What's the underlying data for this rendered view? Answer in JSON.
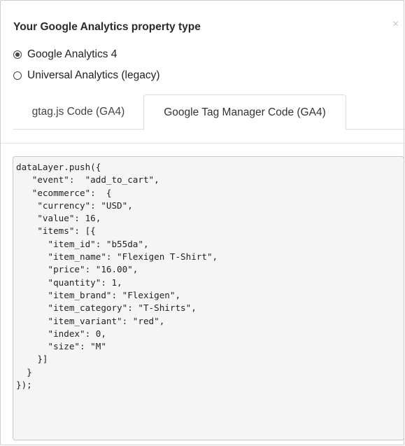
{
  "dialog": {
    "title": "Your Google Analytics property type",
    "close_icon": "close-icon",
    "close_glyph": "×"
  },
  "property_types": [
    {
      "label": "Google Analytics 4",
      "selected": true
    },
    {
      "label": "Universal Analytics (legacy)",
      "selected": false
    }
  ],
  "tabs": [
    {
      "label": "gtag.js Code (GA4)",
      "active": false
    },
    {
      "label": "Google Tag Manager Code (GA4)",
      "active": true
    }
  ],
  "code": {
    "lines": [
      "dataLayer.push({",
      "   \"event\":  \"add_to_cart\",",
      "   \"ecommerce\":  {",
      "    \"currency\": \"USD\",",
      "    \"value\": 16,",
      "    \"items\": [{",
      "      \"item_id\": \"b55da\",",
      "      \"item_name\": \"Flexigen T-Shirt\",",
      "      \"price\": \"16.00\",",
      "      \"quantity\": 1,",
      "      \"item_brand\": \"Flexigen\",",
      "      \"item_category\": \"T-Shirts\",",
      "      \"item_variant\": \"red\",",
      "      \"index\": 0,",
      "      \"size\": \"M\"",
      "    }]",
      "  }",
      "});"
    ]
  }
}
